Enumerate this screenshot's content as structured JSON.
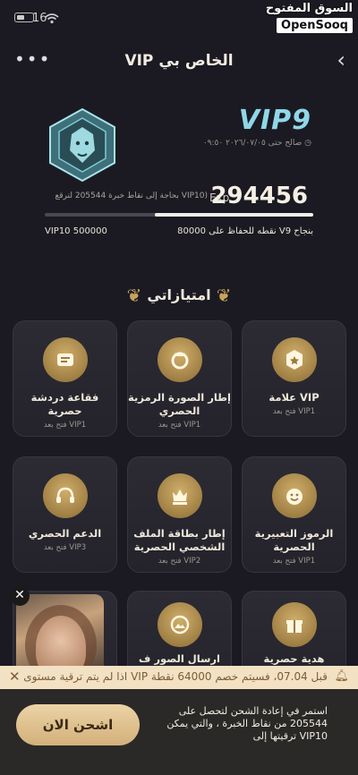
{
  "status": {
    "time": "16"
  },
  "watermark": {
    "arabic": "السوق المفتوح",
    "latin": "OpenSooq"
  },
  "header": {
    "title": "VIP الخاص بي",
    "more": "•••",
    "back": "‹"
  },
  "vip": {
    "level_name": "VIP9",
    "valid_until": "صالح حتى ٢٠٢٦/٠٧/٠٥ ٠٩:٥٠",
    "exp_label": "Exp",
    "exp_value": "294456",
    "need_text": "بحاجة إلى نقاط خبرة 205544 لترقع VIP10)",
    "progress_fraction": 0.59,
    "next_level": "VIP10 500000",
    "keep_text": "80000 نقطه للحفاظ على V9 بنجاح"
  },
  "section": {
    "title": "امتيازاتي"
  },
  "tiles": [
    {
      "title": "علامة VIP",
      "sub": "فتح بعد VIP1",
      "icon": "vip-badge-icon"
    },
    {
      "title": "إطار الصورة الرمزية الحصري",
      "sub": "فتح بعد VIP1",
      "icon": "avatar-frame-icon"
    },
    {
      "title": "فقاعة دردشة حصرية",
      "sub": "فتح بعد VIP1",
      "icon": "chat-bubble-icon"
    },
    {
      "title": "الرموز التعبيرية الحصرية",
      "sub": "فتح بعد VIP1",
      "icon": "emoji-icon"
    },
    {
      "title": "إطار بطاقة الملف الشخصي الحصرية",
      "sub": "فتح بعد VIP2",
      "icon": "profile-card-icon"
    },
    {
      "title": "الدعم الحصري",
      "sub": "فتح بعد VIP3",
      "icon": "headset-icon"
    },
    {
      "title": "هدية حصرية",
      "sub": "",
      "icon": "gift-icon"
    },
    {
      "title": "ارسال الصور ف",
      "sub": "",
      "icon": "image-icon"
    },
    {
      "title": "",
      "sub": "",
      "icon": ""
    }
  ],
  "ticker": {
    "text": "اذا لم يتم ترقية مستوى VIP قبل 07.04، فسيتم خصم 64000 نقطة"
  },
  "bottom": {
    "cta": "اشحن الان",
    "message": "استمر في إعادة الشحن لتحصل على 205544 من نقاط الخبرة ، والتي يمكن ترقيتها إلى VIP10"
  }
}
